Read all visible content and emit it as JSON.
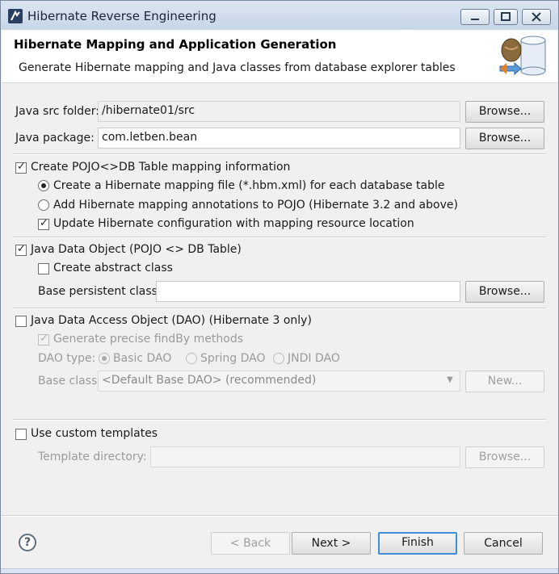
{
  "window": {
    "title": "Hibernate Reverse Engineering"
  },
  "header": {
    "title": "Hibernate Mapping and Application Generation",
    "description": "Generate Hibernate mapping and Java classes from database explorer tables"
  },
  "src_folder": {
    "label": "Java src folder:",
    "value": "/hibernate01/src",
    "browse": "Browse..."
  },
  "package": {
    "label": "Java package:",
    "value": "com.letben.bean",
    "browse": "Browse..."
  },
  "mapping": {
    "label": "Create POJO<>DB Table mapping information",
    "checked": true,
    "option_file": "Create a Hibernate mapping file (*.hbm.xml) for each database table",
    "option_annotations": "Add Hibernate mapping annotations to POJO (Hibernate 3.2 and above)",
    "update_config": "Update Hibernate configuration with mapping resource location"
  },
  "pojo": {
    "label": "Java Data Object (POJO <> DB Table)",
    "abstract_class": "Create abstract class",
    "base_persistent_label": "Base persistent class:",
    "base_persistent_value": "",
    "browse": "Browse..."
  },
  "dao": {
    "label": "Java Data Access Object (DAO) (Hibernate 3 only)",
    "precise_findby": "Generate precise findBy methods",
    "type_label": "DAO type:",
    "type_basic": "Basic DAO",
    "type_spring": "Spring DAO",
    "type_jndi": "JNDI DAO",
    "base_class_label": "Base class:",
    "base_class_value": "<Default Base DAO> (recommended)",
    "new_button": "New..."
  },
  "templates": {
    "label": "Use custom templates",
    "directory_label": "Template directory:",
    "directory_value": "",
    "browse": "Browse..."
  },
  "footer": {
    "help": "?",
    "back": "< Back",
    "next": "Next >",
    "finish": "Finish",
    "cancel": "Cancel"
  }
}
